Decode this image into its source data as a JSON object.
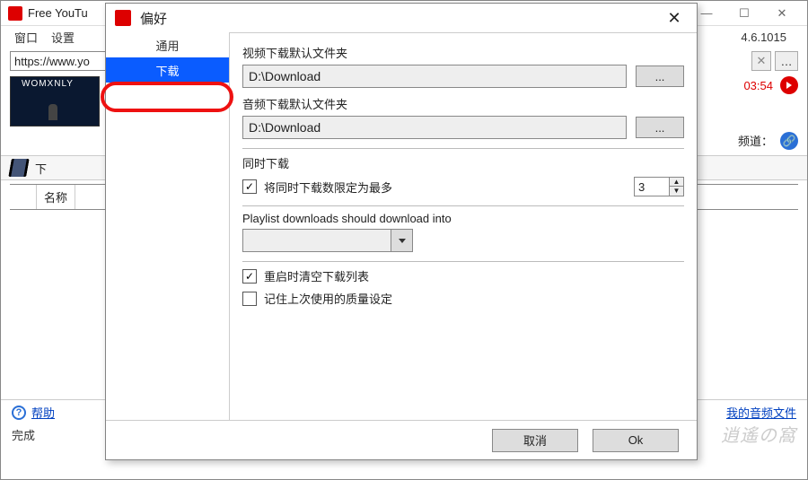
{
  "titlebar": {
    "title": "Free YouTu"
  },
  "menubar": {
    "window": "窗口",
    "settings": "设置",
    "version": "4.6.1015"
  },
  "url": {
    "value": "https://www.yo"
  },
  "video": {
    "duration": "03:54",
    "channel_label": "频道："
  },
  "toolbar": {
    "download": "下"
  },
  "list": {
    "col_name": "名称"
  },
  "bottom": {
    "help": "帮助",
    "my_audio": "我的音频文件",
    "status": "完成"
  },
  "dlg": {
    "title": "偏好",
    "tabs": {
      "general": "通用",
      "download": "下载"
    },
    "video_folder_label": "视频下载默认文件夹",
    "video_folder_value": "D:\\Download",
    "audio_folder_label": "音频下载默认文件夹",
    "audio_folder_value": "D:\\Download",
    "browse": "...",
    "simul_label": "同时下载",
    "limit_label": "将同时下载数限定为最多",
    "limit_value": "3",
    "playlist_label": "Playlist downloads should download into",
    "clear_label": "重启时清空下载列表",
    "remember_label": "记住上次使用的质量设定",
    "cancel": "取消",
    "ok": "Ok"
  },
  "watermark": "逍遙の窩"
}
